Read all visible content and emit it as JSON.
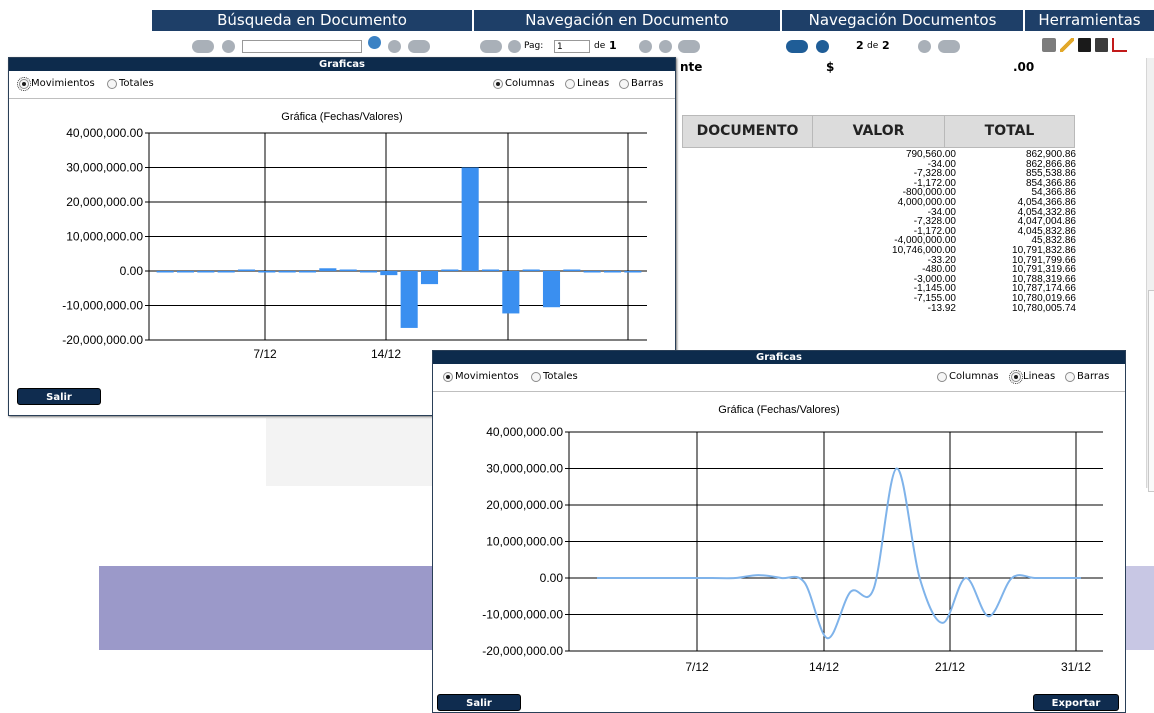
{
  "header": {
    "menu": [
      {
        "label": "Búsqueda en Documento"
      },
      {
        "label": "Navegación en Documento"
      },
      {
        "label": "Navegación Documentos"
      },
      {
        "label": "Herramientas"
      }
    ],
    "search_value": "",
    "page_label": "Pag:",
    "page_value": "1",
    "page_of_label": "de",
    "page_total": "1",
    "doc_current": "2",
    "doc_of_label": "de",
    "doc_total": "2",
    "tool_icons": [
      "printer-icon",
      "pencil-icon",
      "save-icon",
      "export-icon",
      "chart-icon"
    ]
  },
  "document": {
    "partial_row": {
      "label": "nte",
      "currency": "$",
      "value": ".00"
    },
    "columns": [
      "DOCUMENTO",
      "VALOR",
      "TOTAL"
    ],
    "valor": [
      "790,560.00",
      "-34.00",
      "-7,328.00",
      "-1,172.00",
      "-800,000.00",
      "4,000,000.00",
      "-34.00",
      "-7,328.00",
      "-1,172.00",
      "-4,000,000.00",
      "10,746,000.00",
      "-33.20",
      "-480.00",
      "-3,000.00",
      "-1,145.00",
      "-7,155.00",
      "-13.92"
    ],
    "total": [
      "862,900.86",
      "862,866.86",
      "855,538.86",
      "854,366.86",
      "54,366.86",
      "4,054,366.86",
      "4,054,332.86",
      "4,047,004.86",
      "4,045,832.86",
      "45,832.86",
      "10,791,832.86",
      "10,791,799.66",
      "10,791,319.66",
      "10,788,319.66",
      "10,787,174.66",
      "10,780,019.66",
      "10,780,005.74"
    ]
  },
  "window1": {
    "title": "Graficas",
    "opt_movimientos": "Movimientos",
    "opt_totales": "Totales",
    "opt_columnas": "Columnas",
    "opt_lineas": "Lineas",
    "opt_barras": "Barras",
    "selected_mode": "Movimientos",
    "selected_type": "Columnas",
    "close_button": "Salir"
  },
  "window2": {
    "title": "Graficas",
    "opt_movimientos": "Movimientos",
    "opt_totales": "Totales",
    "opt_columnas": "Columnas",
    "opt_lineas": "Lineas",
    "opt_barras": "Barras",
    "selected_mode": "Movimientos",
    "selected_type": "Lineas",
    "close_button": "Salir",
    "export_button": "Exportar"
  },
  "colors": {
    "header": "#1e3f68",
    "title_bar": "#0d2b4c",
    "series": "#3a8ff0",
    "line_series": "#7fb3ea",
    "purple": "#9b99c9"
  },
  "chart_data": [
    {
      "type": "bar",
      "title": "Gráfica (Fechas/Valores)",
      "ylim": [
        -20000000,
        40000000
      ],
      "yticks": [
        -20000000,
        -10000000,
        0,
        10000000,
        20000000,
        30000000,
        40000000
      ],
      "ytick_labels": [
        "-20,000,000.00",
        "-10,000,000.00",
        "0.00",
        "10,000,000.00",
        "20,000,000.00",
        "30,000,000.00",
        "40,000,000.00"
      ],
      "xtick_labels": [
        "7/12",
        "14/12"
      ],
      "grid": true,
      "series": [
        {
          "values": [
            -34,
            -34,
            -7328,
            -1172,
            0,
            -34,
            -7328,
            -1172,
            790560,
            0,
            -33.2,
            -1200000,
            -16500000,
            -3800000,
            0,
            30000000,
            0,
            -12300000,
            0,
            -10500000,
            0,
            -480,
            -145,
            -13.92
          ]
        }
      ]
    },
    {
      "type": "line",
      "title": "Gráfica (Fechas/Valores)",
      "ylim": [
        -20000000,
        40000000
      ],
      "yticks": [
        -20000000,
        -10000000,
        0,
        10000000,
        20000000,
        30000000,
        40000000
      ],
      "ytick_labels": [
        "-20,000,000.00",
        "-10,000,000.00",
        "0.00",
        "10,000,000.00",
        "20,000,000.00",
        "30,000,000.00",
        "40,000,000.00"
      ],
      "xtick_labels": [
        "7/12",
        "14/12",
        "21/12",
        "31/12"
      ],
      "grid": true,
      "series": [
        {
          "values": [
            -34,
            -34,
            -7328,
            -1172,
            -34,
            -7328,
            -1172,
            790560,
            -33.2,
            -1200000,
            -16500000,
            -3800000,
            -3000000,
            30000000,
            0,
            -12300000,
            0,
            -10500000,
            0,
            -480,
            -145,
            -13.92
          ]
        }
      ]
    }
  ]
}
